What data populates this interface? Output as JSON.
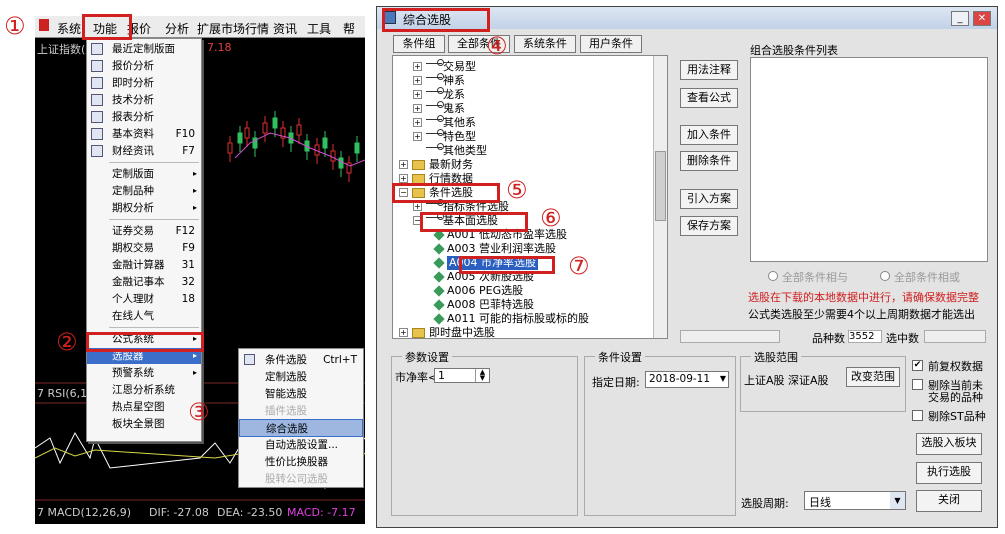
{
  "markers": [
    "①",
    "②",
    "③",
    "④",
    "⑤",
    "⑥",
    "⑦"
  ],
  "left": {
    "menubar": [
      "系统",
      "功能",
      "报价",
      "分析",
      "扩展市场行情",
      "资讯",
      "工具",
      "帮助"
    ],
    "index_label": "上证指数(上",
    "index_value": "7.18",
    "menu": [
      {
        "label": "最近定制版面",
        "icon": "layout-icon"
      },
      {
        "label": "报价分析",
        "icon": "grid-icon"
      },
      {
        "label": "即时分析",
        "icon": "line-icon"
      },
      {
        "label": "技术分析",
        "icon": "candle-icon"
      },
      {
        "label": "报表分析",
        "icon": "table-icon"
      },
      {
        "label": "基本资料",
        "shortcut": "F10",
        "icon": "doc-icon"
      },
      {
        "label": "财经资讯",
        "shortcut": "F7",
        "icon": "news-icon"
      },
      {
        "label": "定制版面",
        "arrow": "▸"
      },
      {
        "label": "定制品种",
        "arrow": "▸"
      },
      {
        "label": "期权分析",
        "arrow": "▸"
      },
      {
        "label": "证券交易",
        "shortcut": "F12"
      },
      {
        "label": "期权交易",
        "shortcut": "F9"
      },
      {
        "label": "金融计算器",
        "shortcut": "31"
      },
      {
        "label": "金融记事本",
        "shortcut": "32"
      },
      {
        "label": "个人理财",
        "shortcut": "18"
      },
      {
        "label": "在线人气"
      },
      {
        "label": "公式系统",
        "arrow": "▸"
      },
      {
        "label": "选股器",
        "arrow": "▸"
      },
      {
        "label": "预警系统",
        "arrow": "▸"
      },
      {
        "label": "江恩分析系统"
      },
      {
        "label": "热点星空图"
      },
      {
        "label": "板块全景图"
      }
    ],
    "submenu": [
      {
        "label": "条件选股",
        "shortcut": "Ctrl+T"
      },
      {
        "label": "定制选股"
      },
      {
        "label": "智能选股"
      },
      {
        "label": "插件选股"
      },
      {
        "label": "综合选股"
      },
      {
        "label": "自动选股设置..."
      },
      {
        "label": "性价比换股器"
      },
      {
        "label": "股转公司选股"
      }
    ],
    "rsi_label": "7 RSI(6,12",
    "macd": {
      "label": "7 MACD(12,26,9)",
      "dif": "DIF: -27.08",
      "dea": "DEA: -23.50",
      "macd": "MACD: -7.17"
    }
  },
  "win": {
    "title": "综合选股",
    "tabs": [
      "条件组",
      "全部条件",
      "系统条件",
      "用户条件"
    ],
    "tree": [
      {
        "label": "交易型",
        "depth": 2,
        "pm": "+"
      },
      {
        "label": "神系",
        "depth": 2,
        "pm": "+"
      },
      {
        "label": "龙系",
        "depth": 2,
        "pm": "+"
      },
      {
        "label": "鬼系",
        "depth": 2,
        "pm": "+"
      },
      {
        "label": "其他系",
        "depth": 2,
        "pm": "+"
      },
      {
        "label": "特色型",
        "depth": 2,
        "pm": "+"
      },
      {
        "label": "其他类型",
        "depth": 2,
        "pm": ""
      },
      {
        "label": "最新财务",
        "depth": 1,
        "pm": "+"
      },
      {
        "label": "行情数据",
        "depth": 1,
        "pm": "+"
      },
      {
        "label": "条件选股",
        "depth": 1,
        "pm": "−"
      },
      {
        "label": "指标条件选股",
        "depth": 2,
        "pm": "+"
      },
      {
        "label": "基本面选股",
        "depth": 2,
        "pm": "−"
      },
      {
        "label": "A001 低动态市盈率选股",
        "depth": 3,
        "pm": ""
      },
      {
        "label": "A003 营业利润率选股",
        "depth": 3,
        "pm": ""
      },
      {
        "label": "A004 市净率选股",
        "depth": 3,
        "pm": "",
        "sel": true
      },
      {
        "label": "A005 次新股选股",
        "depth": 3,
        "pm": ""
      },
      {
        "label": "A006 PEG选股",
        "depth": 3,
        "pm": ""
      },
      {
        "label": "A008 巴菲特选股",
        "depth": 3,
        "pm": ""
      },
      {
        "label": "A011 可能的指标股或标的股",
        "depth": 3,
        "pm": ""
      },
      {
        "label": "即时盘中选股",
        "depth": 1,
        "pm": "+"
      }
    ],
    "buttons": [
      "用法注释",
      "查看公式",
      "加入条件",
      "删除条件",
      "引入方案",
      "保存方案"
    ],
    "list_title": "组合选股条件列表",
    "radio_and": "全部条件相与",
    "radio_or": "全部条件相或",
    "warn": "选股在下载的本地数据中进行，请确保数据完整",
    "note": "公式类选股至少需要4个以上周期数据才能选出",
    "count_label": "品种数",
    "count_value": "3552",
    "selected_label": "选中数",
    "param_title": "参数设置",
    "param_label": "市净率<",
    "param_value": "1",
    "cond_title": "条件设置",
    "date_label": "指定日期:",
    "date_value": "2018-09-11",
    "range_title": "选股范围",
    "range_text": "上证A股 深证A股",
    "range_btn": "改变范围",
    "chk_prev": "前复权数据",
    "chk_exclude1": "剔除当前未",
    "chk_exclude2": "交易的品种",
    "chk_st": "剔除ST品种",
    "btn_block": "选股入板块",
    "btn_exec": "执行选股",
    "period_label": "选股周期:",
    "period_value": "日线",
    "close": "关闭"
  },
  "colors": {
    "accent_red": "#d12020",
    "highlight": "#3a6ec8"
  }
}
